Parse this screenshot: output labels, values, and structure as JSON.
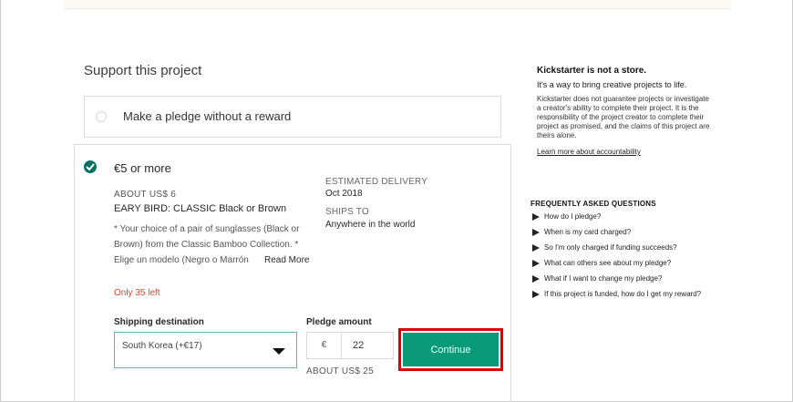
{
  "main": {
    "section_title": "Support this project",
    "no_reward_label": "Make a pledge without a reward",
    "reward": {
      "amount": "€5 or more",
      "about": "ABOUT US$ 6",
      "title": "EARY BIRD: CLASSIC Black or Brown",
      "description": "* Your choice of a pair of sunglasses (Black or Brown) from the Classic Bamboo Collection. * Elige un modelo (Negro o Marrón",
      "read_more": "Read More",
      "estimated_delivery_label": "ESTIMATED DELIVERY",
      "estimated_delivery_value": "Oct 2018",
      "ships_to_label": "SHIPS TO",
      "ships_to_value": "Anywhere in the world",
      "only_left": "Only 35 left",
      "shipping_label": "Shipping destination",
      "shipping_value": "South Korea (+€17)",
      "pledge_label": "Pledge amount",
      "currency": "€",
      "pledge_value": "22",
      "pledge_about": "ABOUT US$ 25",
      "continue_label": "Continue"
    }
  },
  "sidebar": {
    "title": "Kickstarter is not a store.",
    "subtitle": "It's a way to bring creative projects to life.",
    "body": "Kickstarter does not guarantee projects or investigate a creator's ability to complete their project. It is the responsibility of the project creator to complete their project as promised, and the claims of this project are theirs alone.",
    "link": "Learn more about accountability",
    "faq_title": "FREQUENTLY ASKED QUESTIONS",
    "faq": [
      "How do I pledge?",
      "When is my card charged?",
      "So I'm only charged if funding succeeds?",
      "What can others see about my pledge?",
      "What if I want to change my pledge?",
      "If this project is funded, how do I get my reward?"
    ]
  },
  "colors": {
    "accent": "#0b9a78",
    "check": "#037362",
    "highlight": "#e00000",
    "warning": "#e0412e"
  }
}
